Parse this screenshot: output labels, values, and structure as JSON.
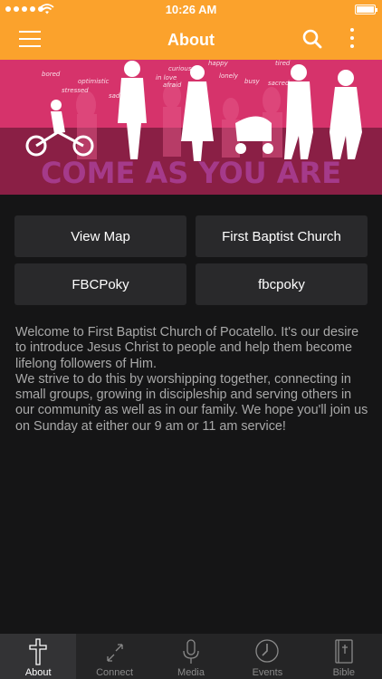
{
  "status_bar": {
    "time": "10:26 AM"
  },
  "nav": {
    "title": "About"
  },
  "banner": {
    "headline": "COME AS YOU ARE",
    "words": [
      "bored",
      "optimistic",
      "stressed",
      "curious",
      "in love",
      "happy",
      "lonely",
      "busy",
      "tired",
      "sacred",
      "afraid",
      "sad"
    ]
  },
  "buttons": [
    {
      "label": "View Map"
    },
    {
      "label": "First Baptist Church"
    },
    {
      "label": "FBCPoky"
    },
    {
      "label": "fbcpoky"
    }
  ],
  "description": "Welcome to First Baptist Church of Pocatello. It's our desire to introduce Jesus Christ to people and help them become lifelong followers of Him.\nWe strive to do this by worshipping together, connecting in small groups, growing in discipleship and serving others in our community as well as in our family. We hope you'll join us on Sunday at either our 9 am or 11 am service!",
  "tabs": [
    {
      "label": "About",
      "icon": "cross-icon",
      "active": true
    },
    {
      "label": "Connect",
      "icon": "connect-icon",
      "active": false
    },
    {
      "label": "Media",
      "icon": "microphone-icon",
      "active": false
    },
    {
      "label": "Events",
      "icon": "clock-icon",
      "active": false
    },
    {
      "label": "Bible",
      "icon": "bible-icon",
      "active": false
    }
  ],
  "colors": {
    "accent": "#fba22c",
    "background": "#151516",
    "button": "#29292b",
    "text_muted": "#a9a9a9",
    "banner_pink": "#d6336b",
    "banner_dark": "#8a1f45",
    "banner_text": "#a53a8a"
  }
}
